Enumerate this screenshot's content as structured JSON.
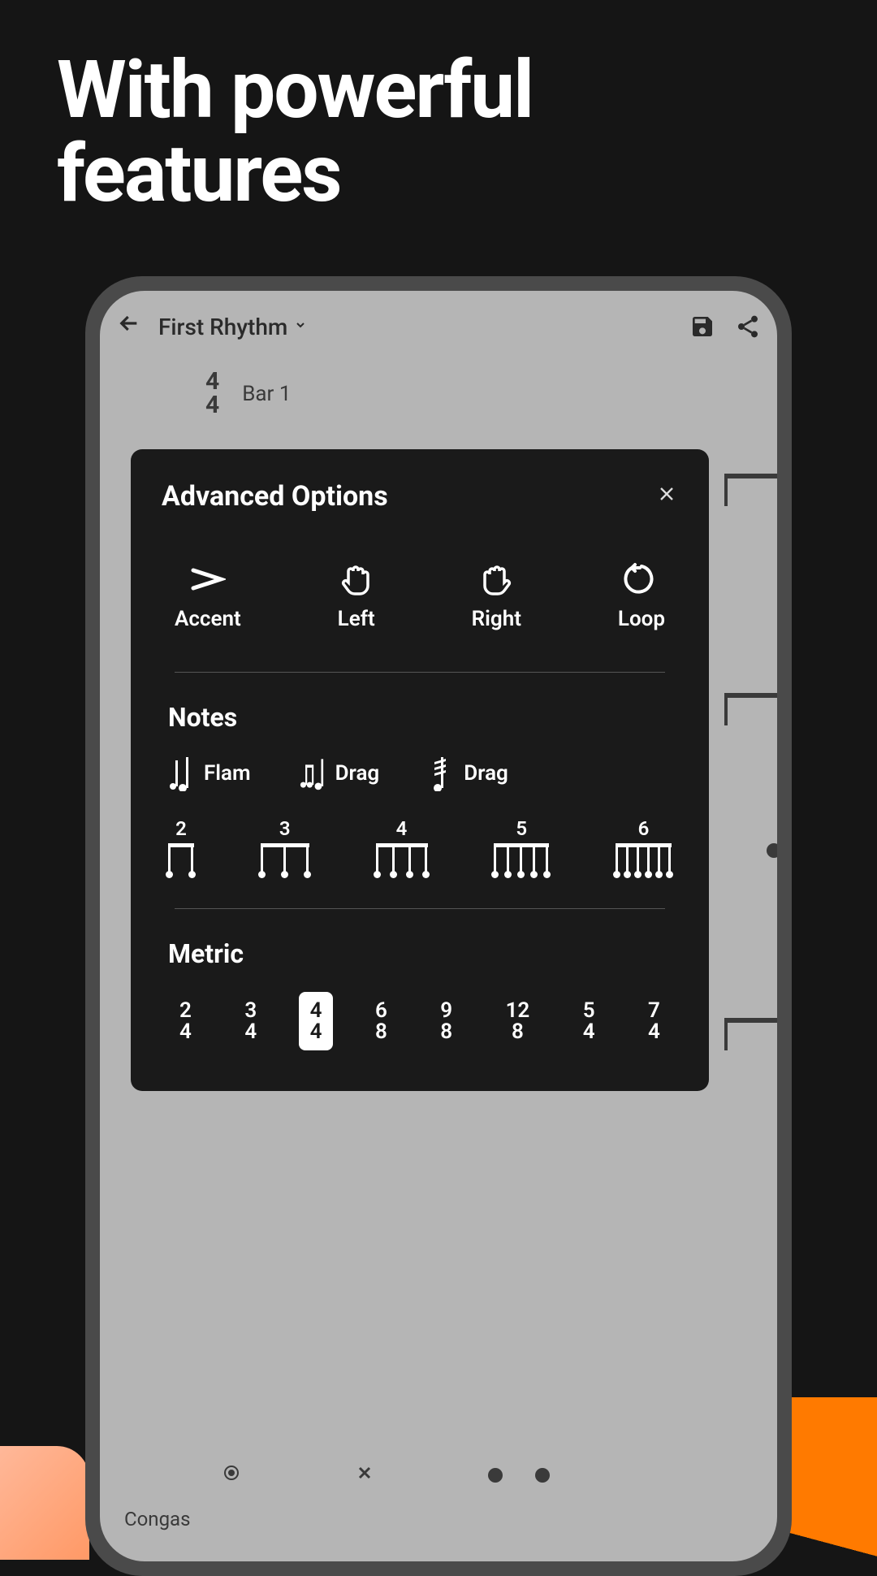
{
  "hero": {
    "line1": "With powerful",
    "line2": "features"
  },
  "header": {
    "title": "First Rhythm"
  },
  "timeSignature": {
    "top": "4",
    "bottom": "4"
  },
  "barLabel": "Bar 1",
  "instrument": "Congas",
  "modal": {
    "title": "Advanced Options",
    "options": [
      {
        "id": "accent",
        "label": "Accent"
      },
      {
        "id": "left",
        "label": "Left"
      },
      {
        "id": "right",
        "label": "Right"
      },
      {
        "id": "loop",
        "label": "Loop"
      }
    ],
    "notesHeading": "Notes",
    "noteTypes": [
      {
        "id": "flam",
        "label": "Flam"
      },
      {
        "id": "drag1",
        "label": "Drag"
      },
      {
        "id": "drag2",
        "label": "Drag"
      }
    ],
    "tuplets": [
      "2",
      "3",
      "4",
      "5",
      "6"
    ],
    "metricHeading": "Metric",
    "metrics": [
      {
        "top": "2",
        "bottom": "4",
        "selected": false
      },
      {
        "top": "3",
        "bottom": "4",
        "selected": false
      },
      {
        "top": "4",
        "bottom": "4",
        "selected": true
      },
      {
        "top": "6",
        "bottom": "8",
        "selected": false
      },
      {
        "top": "9",
        "bottom": "8",
        "selected": false
      },
      {
        "top": "12",
        "bottom": "8",
        "selected": false
      },
      {
        "top": "5",
        "bottom": "4",
        "selected": false
      },
      {
        "top": "7",
        "bottom": "4",
        "selected": false
      }
    ]
  }
}
